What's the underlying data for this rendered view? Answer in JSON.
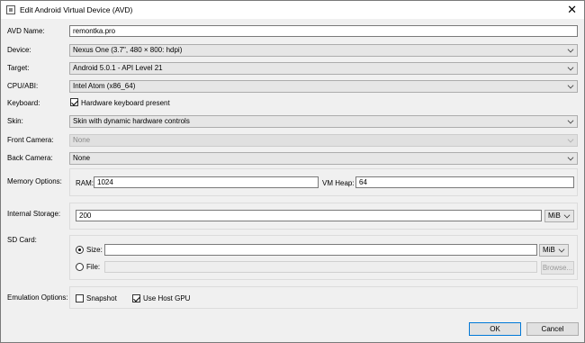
{
  "window": {
    "title": "Edit Android Virtual Device (AVD)"
  },
  "form": {
    "avd_name": {
      "label": "AVD Name:",
      "value": "remontka.pro"
    },
    "device": {
      "label": "Device:",
      "value": "Nexus One (3.7\", 480 × 800: hdpi)"
    },
    "target": {
      "label": "Target:",
      "value": "Android 5.0.1 - API Level 21"
    },
    "cpu_abi": {
      "label": "CPU/ABI:",
      "value": "Intel Atom (x86_64)"
    },
    "keyboard": {
      "label": "Keyboard:",
      "checkbox_label": "Hardware keyboard present",
      "checked": true
    },
    "skin": {
      "label": "Skin:",
      "value": "Skin with dynamic hardware controls"
    },
    "front_camera": {
      "label": "Front Camera:",
      "value": "None"
    },
    "back_camera": {
      "label": "Back Camera:",
      "value": "None"
    },
    "memory": {
      "label": "Memory Options:",
      "ram_label": "RAM:",
      "ram_value": "1024",
      "vm_heap_label": "VM Heap:",
      "vm_heap_value": "64"
    },
    "internal_storage": {
      "label": "Internal Storage:",
      "value": "200",
      "unit": "MiB"
    },
    "sd_card": {
      "label": "SD Card:",
      "size_label": "Size:",
      "size_value": "",
      "size_unit": "MiB",
      "file_label": "File:",
      "file_value": "",
      "browse_label": "Browse..."
    },
    "emulation": {
      "label": "Emulation Options:",
      "snapshot_label": "Snapshot",
      "snapshot_checked": false,
      "host_gpu_label": "Use Host GPU",
      "host_gpu_checked": true
    }
  },
  "buttons": {
    "ok": "OK",
    "cancel": "Cancel"
  },
  "icons": {
    "app": "window-icon",
    "close": "close-icon"
  }
}
